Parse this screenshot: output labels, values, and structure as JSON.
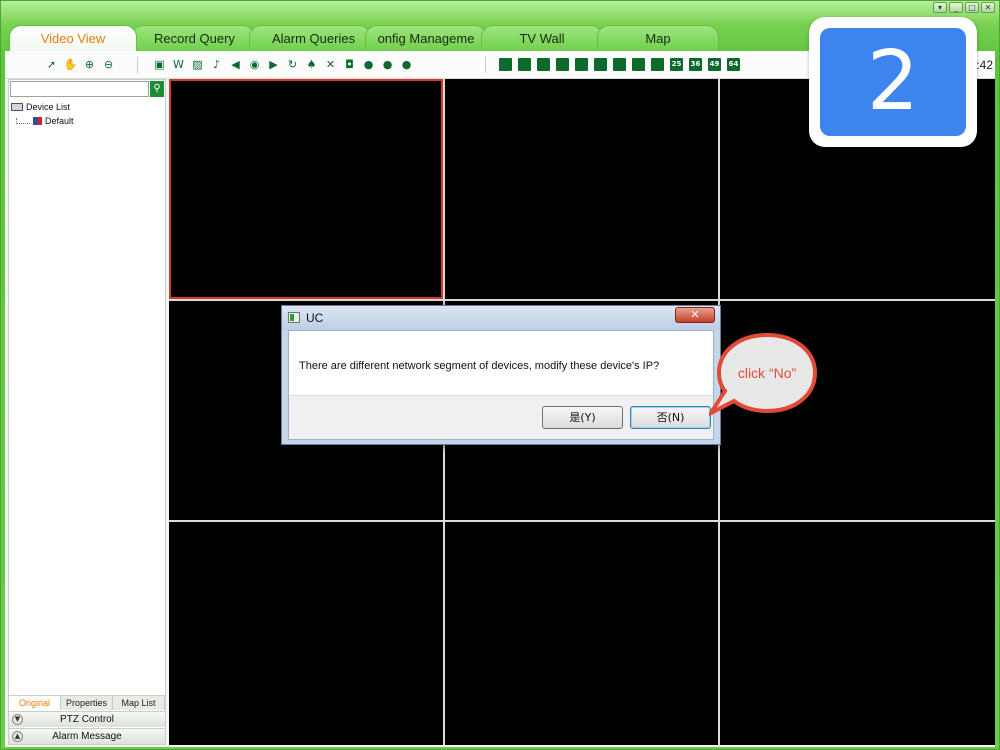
{
  "window": {
    "controls": [
      "▾",
      "_",
      "□",
      "✕"
    ]
  },
  "tabs": [
    {
      "label": "Video View",
      "active": true
    },
    {
      "label": "Record Query",
      "active": false
    },
    {
      "label": "Alarm Queries",
      "active": false
    },
    {
      "label": "onfig Manageme",
      "active": false
    },
    {
      "label": "TV Wall",
      "active": false
    },
    {
      "label": "Map",
      "active": false
    }
  ],
  "toolbar": {
    "clock": ":42",
    "group1": [
      {
        "icon": "pointer-icon",
        "glyph": "➚"
      },
      {
        "icon": "hand-icon",
        "glyph": "✋"
      },
      {
        "icon": "zoom-in-icon",
        "glyph": "⊕"
      },
      {
        "icon": "zoom-out-icon",
        "glyph": "⊖"
      }
    ],
    "group2": [
      {
        "icon": "fullscreen-icon",
        "glyph": "▣"
      },
      {
        "icon": "aspect-icon",
        "glyph": "W"
      },
      {
        "icon": "snapshot-icon",
        "glyph": "▨"
      },
      {
        "icon": "microphone-icon",
        "glyph": "♪"
      },
      {
        "icon": "speaker-icon",
        "glyph": "◀"
      },
      {
        "icon": "broadcast-icon",
        "glyph": "◉"
      },
      {
        "icon": "record-icon",
        "glyph": "▶"
      },
      {
        "icon": "refresh-icon",
        "glyph": "↻"
      },
      {
        "icon": "alarm-icon",
        "glyph": "♠"
      },
      {
        "icon": "close-all-icon",
        "glyph": "✕"
      },
      {
        "icon": "monitor-icon",
        "glyph": "◘"
      },
      {
        "icon": "play-icon",
        "glyph": "●"
      },
      {
        "icon": "stop-icon",
        "glyph": "●"
      },
      {
        "icon": "pause-icon",
        "glyph": "●"
      }
    ],
    "layouts": [
      "",
      "",
      "",
      "",
      "",
      "",
      "",
      "",
      "",
      "25",
      "36",
      "49",
      "64"
    ]
  },
  "search": {
    "placeholder": ""
  },
  "tree": {
    "root": "Device List",
    "child": "Default"
  },
  "left_tabs": [
    {
      "label": "Original",
      "active": true
    },
    {
      "label": "Properties",
      "active": false
    },
    {
      "label": "Map List",
      "active": false
    }
  ],
  "panels": {
    "ptz": "PTZ Control",
    "alarm": "Alarm Message"
  },
  "badge": {
    "step": "2"
  },
  "dialog": {
    "title": "UC",
    "close": "✕",
    "message": "There are different network segment of devices, modify these device's IP?",
    "yes": "是(Y)",
    "no": "否(N)"
  },
  "callout": {
    "text": "click “No”"
  }
}
